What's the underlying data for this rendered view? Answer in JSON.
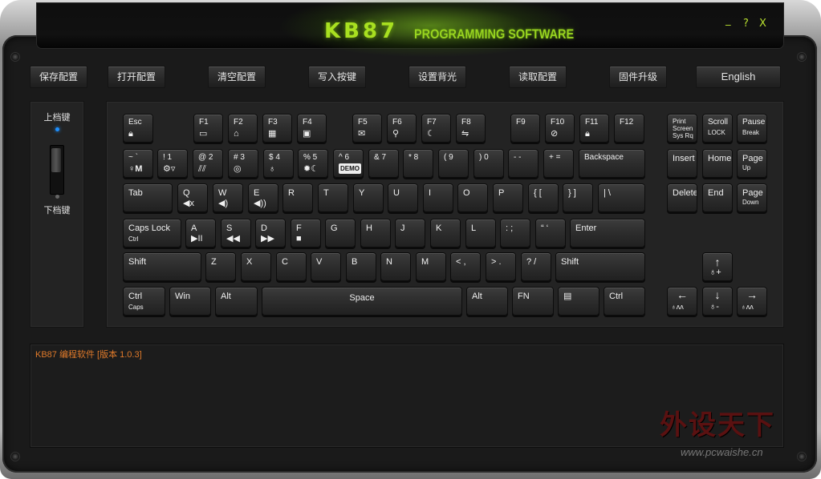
{
  "header": {
    "logo": "KB87",
    "subtitle": "PROGRAMMING SOFTWARE",
    "minimize": "_",
    "help": "?",
    "close": "X"
  },
  "toolbar": {
    "save": "保存配置",
    "open": "打开配置",
    "clear": "清空配置",
    "write": "写入按键",
    "backlight": "设置背光",
    "read": "读取配置",
    "firmware": "固件升级",
    "language": "English"
  },
  "side": {
    "upper": "上档键",
    "lower": "下档键"
  },
  "keys": {
    "esc": "Esc",
    "f1": "F1",
    "f2": "F2",
    "f3": "F3",
    "f4": "F4",
    "f5": "F5",
    "f6": "F6",
    "f7": "F7",
    "f8": "F8",
    "f9": "F9",
    "f10": "F10",
    "f11": "F11",
    "f12": "F12",
    "print_screen_1": "Print",
    "print_screen_2": "Screen",
    "print_screen_3": "Sys Rq",
    "scroll_lock_1": "Scroll",
    "scroll_lock_2": "LOCK",
    "pause_1": "Pause",
    "pause_2": "Break",
    "tilde": "~ `",
    "n1": "! 1",
    "n2": "@ 2",
    "n3": "# 3",
    "n4": "$ 4",
    "n5": "% 5",
    "n6": "^ 6",
    "n7": "& 7",
    "n8": "* 8",
    "n9": "( 9",
    "n0": ") 0",
    "minus": "- -",
    "equal": "+ =",
    "backspace": "Backspace",
    "insert": "Insert",
    "home": "Home",
    "page_up_1": "Page",
    "page_up_2": "Up",
    "tab": "Tab",
    "q": "Q",
    "w": "W",
    "e": "E",
    "r": "R",
    "t": "T",
    "y": "Y",
    "u": "U",
    "i": "I",
    "o": "O",
    "p": "P",
    "lbracket": "{ [",
    "rbracket": "} ]",
    "backslash": "| \\",
    "delete": "Delete",
    "end": "End",
    "page_down_1": "Page",
    "page_down_2": "Down",
    "caps_lock": "Caps Lock",
    "caps_ctrl": "Ctrl",
    "a": "A",
    "s": "S",
    "d": "D",
    "f": "F",
    "g": "G",
    "h": "H",
    "j": "J",
    "k": "K",
    "l": "L",
    "semicolon": ": ;",
    "quote": "“ ‘",
    "enter": "Enter",
    "lshift": "Shift",
    "z": "Z",
    "x": "X",
    "c": "C",
    "v": "V",
    "b": "B",
    "n": "N",
    "m": "M",
    "comma": "< ,",
    "period": "> .",
    "slash": "? /",
    "rshift": "Shift",
    "lctrl": "Ctrl",
    "lctrl_sub": "Caps",
    "win": "Win",
    "lalt": "Alt",
    "space": "Space",
    "ralt": "Alt",
    "fn": "FN",
    "rctrl": "Ctrl",
    "up": "↑",
    "left": "←",
    "down": "↓",
    "right": "→",
    "demo": "DEMO"
  },
  "log": {
    "line1": "KB87 编程软件 [版本 1.0.3]"
  },
  "watermark": {
    "cn": "外设天下",
    "url": "www.pcwaishe.cn"
  }
}
